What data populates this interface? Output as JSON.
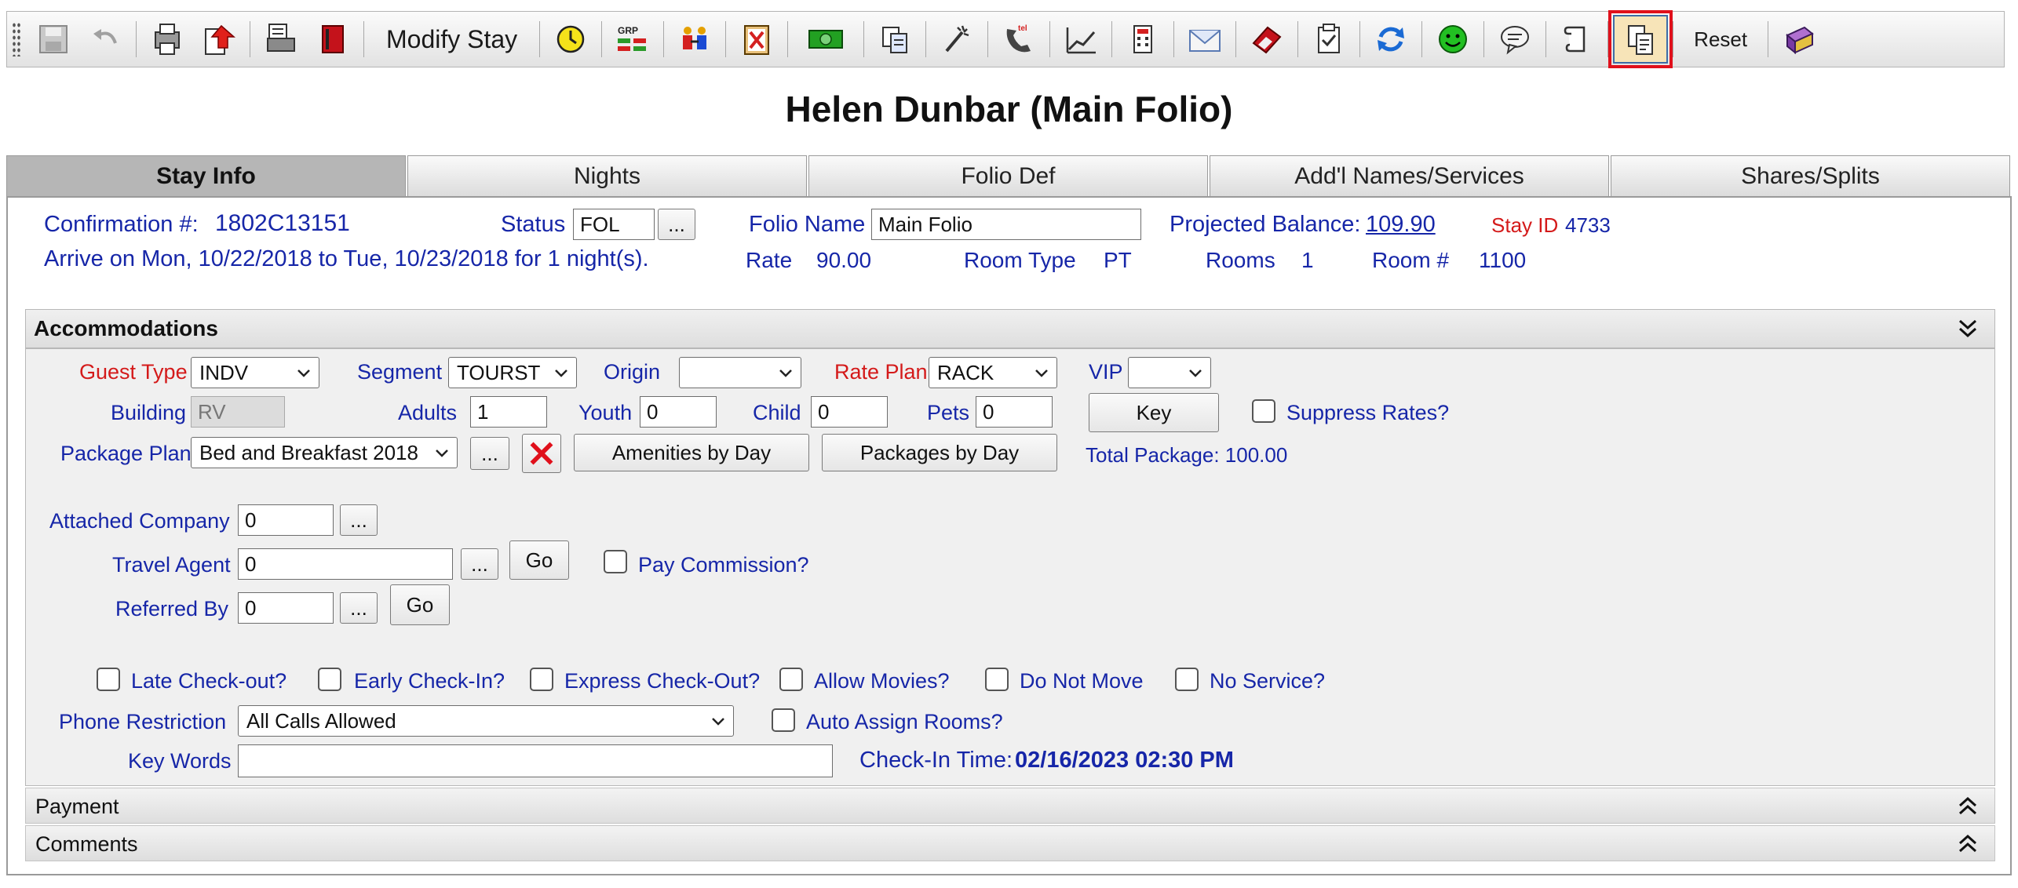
{
  "toolbar": {
    "modify_stay_label": "Modify Stay",
    "reset_label": "Reset",
    "icons": [
      "save-icon",
      "undo-icon",
      "print-folio-icon",
      "post-charge-icon",
      "print-registration-icon",
      "book-icon",
      "grp-icon",
      "people-icon",
      "cancel-clipboard-icon",
      "money-icon",
      "copy-icon",
      "key-wand-icon",
      "tel-icon",
      "graph-icon",
      "calculator-icon",
      "envelope-icon",
      "eraser-icon",
      "checklist-icon",
      "refresh-icon",
      "smiley-icon",
      "chat-bubble-icon",
      "scroll-icon",
      "folio-history-icon",
      "purple-book-icon"
    ]
  },
  "title": "Helen Dunbar (Main Folio)",
  "tabs": [
    "Stay Info",
    "Nights",
    "Folio Def",
    "Add'l Names/Services",
    "Shares/Splits"
  ],
  "stay": {
    "confirmation_label": "Confirmation #:",
    "confirmation_value": "1802C13151",
    "status_label": "Status",
    "status_value": "FOL",
    "ellipsis": "...",
    "folio_name_label": "Folio Name",
    "folio_name_value": "Main Folio",
    "projected_balance_label": "Projected Balance:",
    "projected_balance_value": "109.90",
    "stay_id_label": "Stay ID",
    "stay_id_value": "4733",
    "arrive_text": "Arrive on Mon, 10/22/2018 to Tue, 10/23/2018 for 1 night(s).",
    "rate_label": "Rate",
    "rate_value": "90.00",
    "room_type_label": "Room Type",
    "room_type_value": "PT",
    "rooms_label": "Rooms",
    "rooms_value": "1",
    "room_no_label": "Room #",
    "room_no_value": "1100"
  },
  "accommodations": {
    "header": "Accommodations",
    "guest_type_label": "Guest Type",
    "guest_type_value": "INDV",
    "segment_label": "Segment",
    "segment_value": "TOURST",
    "origin_label": "Origin",
    "origin_value": "",
    "rate_plan_label": "Rate Plan",
    "rate_plan_value": "RACK",
    "vip_label": "VIP",
    "vip_value": "",
    "building_label": "Building",
    "building_value": "RV",
    "adults_label": "Adults",
    "adults_value": "1",
    "youth_label": "Youth",
    "youth_value": "0",
    "child_label": "Child",
    "child_value": "0",
    "pets_label": "Pets",
    "pets_value": "0",
    "key_button": "Key",
    "suppress_rates_label": "Suppress Rates?",
    "package_plan_label": "Package Plan",
    "package_plan_value": "Bed and Breakfast 2018",
    "amenities_button": "Amenities by Day",
    "packages_button": "Packages by Day",
    "total_package_text": "Total Package: 100.00",
    "attached_company_label": "Attached Company",
    "attached_company_value": "0",
    "travel_agent_label": "Travel Agent",
    "travel_agent_value": "0",
    "go_label": "Go",
    "pay_commission_label": "Pay Commission?",
    "referred_by_label": "Referred By",
    "referred_by_value": "0",
    "late_checkout_label": "Late Check-out?",
    "early_checkin_label": "Early Check-In?",
    "express_checkout_label": "Express Check-Out?",
    "allow_movies_label": "Allow Movies?",
    "do_not_move_label": "Do Not Move",
    "no_service_label": "No Service?",
    "phone_restriction_label": "Phone Restriction",
    "phone_restriction_value": "All Calls Allowed",
    "auto_assign_label": "Auto Assign Rooms?",
    "key_words_label": "Key Words",
    "key_words_value": "",
    "checkin_time_label": "Check-In Time:",
    "checkin_time_value": "02/16/2023 02:30 PM"
  },
  "payment_header": "Payment",
  "comments_header": "Comments",
  "colors": {
    "label_blue": "#1626a8",
    "required_red": "#d41a1a",
    "highlight_red": "#e0101b"
  }
}
